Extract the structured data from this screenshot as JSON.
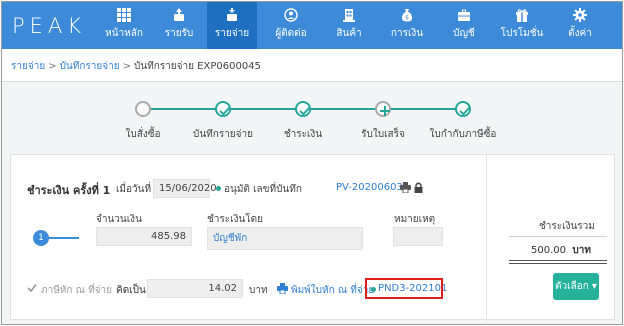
{
  "brand": {
    "logo": "PEAK",
    "nav_color": "#3d8ad8",
    "nav_active_color": "#1f6fc0",
    "teal": "#26a69a"
  },
  "nav": [
    {
      "label": "หน้าหลัก",
      "icon": "grid-icon"
    },
    {
      "label": "รายรับ",
      "icon": "cash-in-icon"
    },
    {
      "label": "รายจ่าย",
      "icon": "cash-out-icon",
      "active": true
    },
    {
      "label": "ผู้ติดต่อ",
      "icon": "contact-icon"
    },
    {
      "label": "สินค้า",
      "icon": "building-icon"
    },
    {
      "label": "การเงิน",
      "icon": "money-bag-icon"
    },
    {
      "label": "บัญชี",
      "icon": "briefcase-icon"
    },
    {
      "label": "โปรโมชั่น",
      "icon": "gift-icon"
    },
    {
      "label": "ตั้งค่า",
      "icon": "gear-icon"
    }
  ],
  "breadcrumb": {
    "item1": "รายจ่าย",
    "item2": "บันทึกรายจ่าย",
    "current": "บันทึกรายจ่าย EXP0600045",
    "separator": ">"
  },
  "steps": [
    {
      "label": "ใบสั่งซื้อ",
      "state": "empty"
    },
    {
      "label": "บันทึกรายจ่าย",
      "state": "done"
    },
    {
      "label": "ชำระเงิน",
      "state": "done"
    },
    {
      "label": "รับใบเสร็จ",
      "state": "add"
    },
    {
      "label": "ใบกำกับภาษีซื้อ",
      "state": "done"
    }
  ],
  "payment": {
    "title": "ชำระเงิน ครั้งที่ 1",
    "date_label": "เมื่อวันที่",
    "date_value": "15/06/2020",
    "approved_text": "อนุมัติ เลขที่บันทึก",
    "record_no": "PV-202006030",
    "step_number": "1",
    "amount_label": "จำนวนเงิน",
    "amount_value": "485.98",
    "paid_by_label": "ชำระเงินโดย",
    "paid_by_value": "บัญชีพัก",
    "note_label": "หมายเหตุ",
    "note_value": "",
    "withholding_label": "ภาษีหัก ณ ที่จ่าย",
    "calc_label": "คิดเป็น",
    "withholding_amount": "14.02",
    "currency_unit": "บาท",
    "print_link": "พิมพ์ใบหัก ณ ที่จ่าย",
    "doc_no": "PND3-202101"
  },
  "summary": {
    "label": "ชำระเงินรวม",
    "value": "500.00",
    "unit": "บาท"
  },
  "options_button": "ตัวเลือก"
}
